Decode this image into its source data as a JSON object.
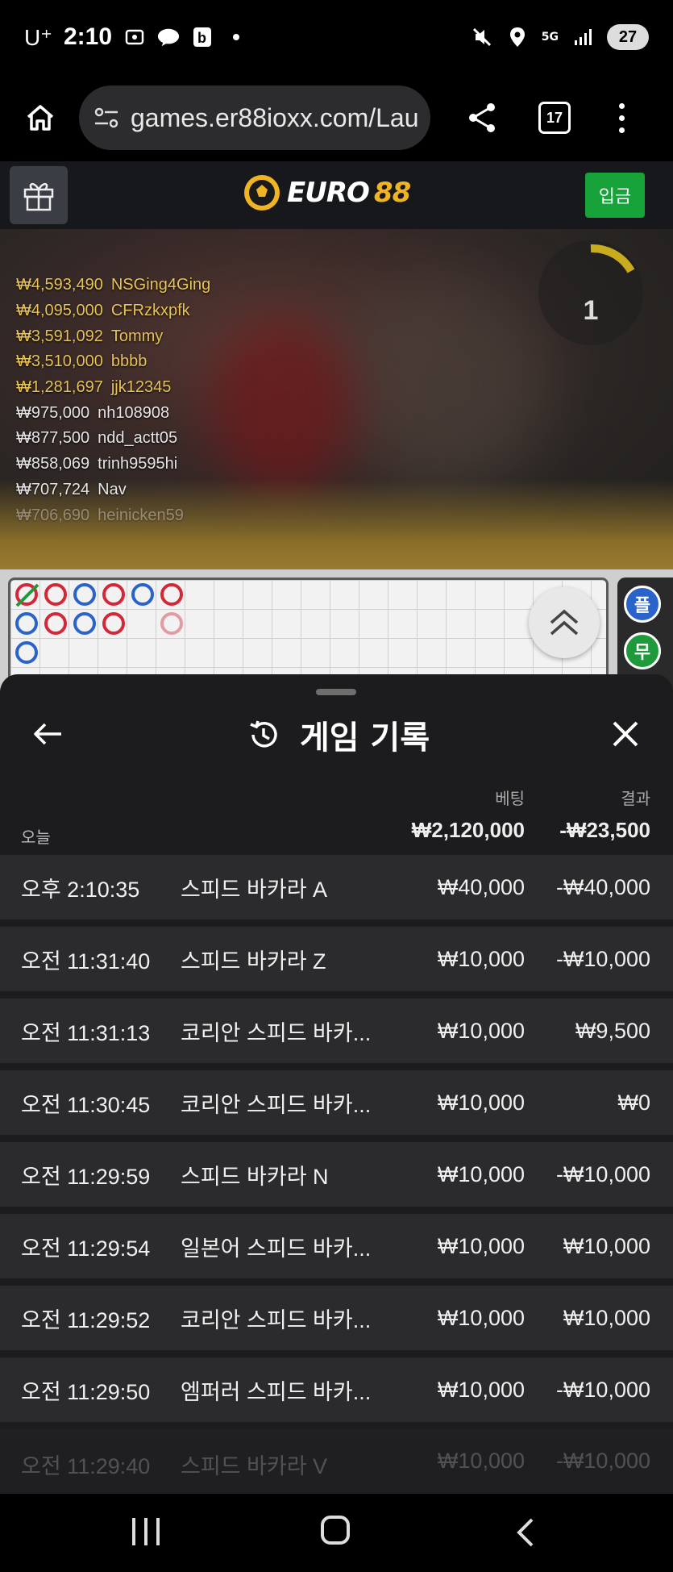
{
  "status_bar": {
    "carrier": "U⁺",
    "time": "2:10",
    "battery": "27",
    "network": "5G"
  },
  "browser": {
    "url": "games.er88ioxx.com/Lau",
    "tab_count": "17"
  },
  "site": {
    "logo_euro": "EURO",
    "logo_num": "88",
    "deposit_label": "입금"
  },
  "video": {
    "timer_value": "1",
    "winners": [
      {
        "amount": "₩4,593,490",
        "name": "NSGing4Ging",
        "style": "gold"
      },
      {
        "amount": "₩4,095,000",
        "name": "CFRzkxpfk",
        "style": "gold"
      },
      {
        "amount": "₩3,591,092",
        "name": "Tommy",
        "style": "gold"
      },
      {
        "amount": "₩3,510,000",
        "name": "bbbb",
        "style": "gold"
      },
      {
        "amount": "₩1,281,697",
        "name": "jjk12345",
        "style": "gold"
      },
      {
        "amount": "₩975,000",
        "name": "nh108908",
        "style": "white"
      },
      {
        "amount": "₩877,500",
        "name": "ndd_actt05",
        "style": "white"
      },
      {
        "amount": "₩858,069",
        "name": "trinh9595hi",
        "style": "white"
      },
      {
        "amount": "₩707,724",
        "name": "Nav",
        "style": "white"
      },
      {
        "amount": "₩706,690",
        "name": "heinicken59",
        "style": "white"
      }
    ]
  },
  "side_panel": {
    "chip_player": "플",
    "chip_tie": "무"
  },
  "sheet": {
    "title": "게임 기록",
    "col_bet": "베팅",
    "col_result": "결과",
    "today_label": "오늘",
    "today_bet": "₩2,120,000",
    "today_result": "-₩23,500",
    "rows": [
      {
        "time": "오후 2:10:35",
        "game": "스피드 바카라 A",
        "bet": "₩40,000",
        "result": "-₩40,000"
      },
      {
        "time": "오전 11:31:40",
        "game": "스피드 바카라 Z",
        "bet": "₩10,000",
        "result": "-₩10,000"
      },
      {
        "time": "오전 11:31:13",
        "game": "코리안 스피드 바카...",
        "bet": "₩10,000",
        "result": "₩9,500"
      },
      {
        "time": "오전 11:30:45",
        "game": "코리안 스피드 바카...",
        "bet": "₩10,000",
        "result": "₩0"
      },
      {
        "time": "오전 11:29:59",
        "game": "스피드 바카라 N",
        "bet": "₩10,000",
        "result": "-₩10,000"
      },
      {
        "time": "오전 11:29:54",
        "game": "일본어 스피드 바카...",
        "bet": "₩10,000",
        "result": "₩10,000"
      },
      {
        "time": "오전 11:29:52",
        "game": "코리안 스피드 바카...",
        "bet": "₩10,000",
        "result": "₩10,000"
      },
      {
        "time": "오전 11:29:50",
        "game": "엠퍼러 스피드 바카...",
        "bet": "₩10,000",
        "result": "-₩10,000"
      },
      {
        "time": "오전 11:29:40",
        "game": "스피드 바카라 V",
        "bet": "₩10,000",
        "result": "-₩10,000"
      }
    ]
  },
  "colors": {
    "accent_gold": "#f0b323",
    "deposit_green": "#17a23a",
    "banker_red": "#d3283a",
    "player_blue": "#2a63c9"
  }
}
